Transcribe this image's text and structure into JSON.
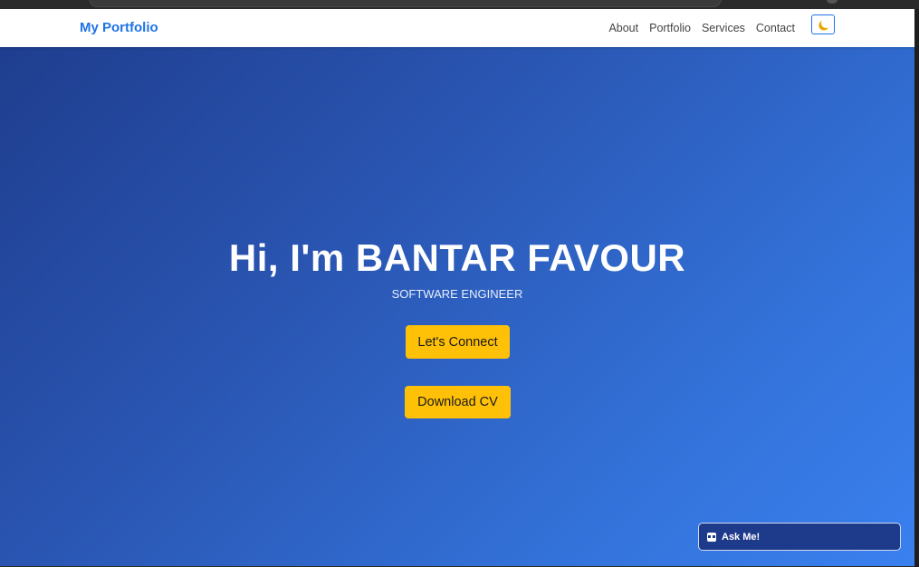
{
  "navbar": {
    "brand": "My Portfolio",
    "links": [
      "About",
      "Portfolio",
      "Services",
      "Contact"
    ],
    "theme_toggle_icon": "moon-icon"
  },
  "hero": {
    "title": "Hi, I'm BANTAR FAVOUR",
    "subtitle": "SOFTWARE ENGINEER",
    "connect_label": "Let's Connect",
    "cv_label": "Download CV"
  },
  "chat": {
    "label": "Ask Me!",
    "icon": "robot-icon"
  },
  "colors": {
    "brand": "#1e73e6",
    "hero_gradient_start": "#1e3c8c",
    "hero_gradient_end": "#3a80ef",
    "button": "#ffc107",
    "chat_bg": "#1e3a8a"
  }
}
